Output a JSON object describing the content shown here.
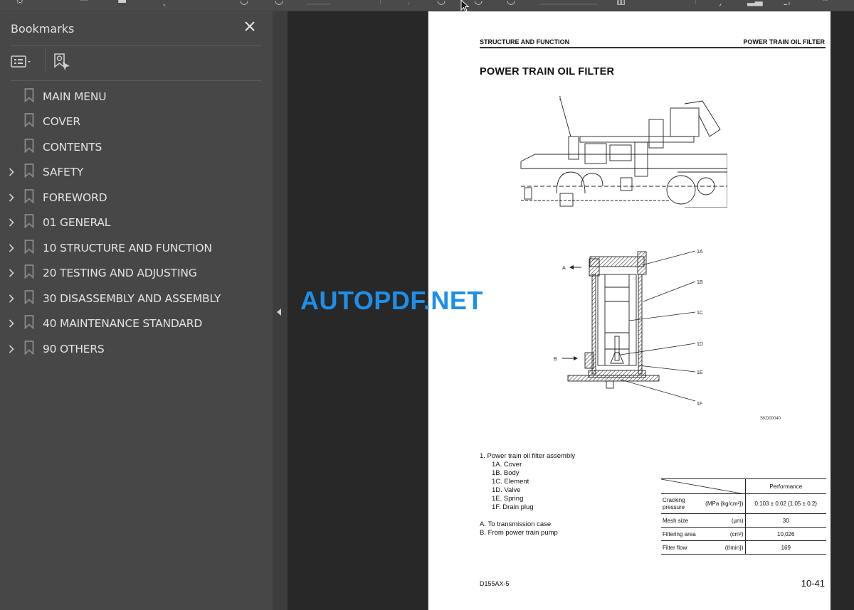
{
  "toolbar": {
    "icons": [
      "bookmark-star-icon",
      "upload-icon",
      "print-icon",
      "save-icon",
      "search-icon",
      "prev-page-icon",
      "next-page-icon",
      "select-cursor-icon",
      "zoom-out-icon",
      "zoom-in-icon",
      "fit-page-icon",
      "rotate-icon",
      "comment-icon",
      "highlight-icon",
      "sign-icon",
      "more-tools-icon"
    ]
  },
  "sidebar": {
    "title": "Bookmarks",
    "close_label": "✕",
    "items": [
      {
        "label": "MAIN MENU",
        "expandable": false
      },
      {
        "label": "COVER",
        "expandable": false
      },
      {
        "label": "CONTENTS",
        "expandable": false
      },
      {
        "label": "SAFETY",
        "expandable": true
      },
      {
        "label": "FOREWORD",
        "expandable": true
      },
      {
        "label": "01 GENERAL",
        "expandable": true
      },
      {
        "label": "10 STRUCTURE AND FUNCTION",
        "expandable": true
      },
      {
        "label": "20 TESTING AND ADJUSTING",
        "expandable": true
      },
      {
        "label": "30 DISASSEMBLY AND ASSEMBLY",
        "expandable": true
      },
      {
        "label": "40 MAINTENANCE STANDARD",
        "expandable": true
      },
      {
        "label": "90 OTHERS",
        "expandable": true
      }
    ]
  },
  "document": {
    "header_left": "STRUCTURE AND FUNCTION",
    "header_right": "POWER TRAIN OIL FILTER",
    "title": "POWER TRAIN OIL FILTER",
    "figure_callouts": {
      "top": "1",
      "a": "A",
      "b": "B",
      "c1a": "1A",
      "c1b": "1B",
      "c1c": "1C",
      "c1d": "1D",
      "c1e": "1E",
      "c1f": "1F"
    },
    "figure_code": "SKD00040",
    "parts": {
      "main": "1.  Power train oil filter assembly",
      "subs": [
        "1A. Cover",
        "1B. Body",
        "1C. Element",
        "1D. Valve",
        "1E. Spring",
        "1F. Drain plug"
      ],
      "flows": [
        "A.  To transmission case",
        "B.  From power train pump"
      ]
    },
    "performance_table": {
      "header": "Performance",
      "rows": [
        {
          "label": "Cracking pressure",
          "label_line1": "Cracking",
          "label_line2": "pressure",
          "unit": "(MPa {kg/cm²})",
          "value": "0.103 ± 0.02 {1.05 ± 0.2}"
        },
        {
          "label": "Mesh size",
          "unit": "(µm)",
          "value": "30"
        },
        {
          "label": "Filtering area",
          "unit": "(cm²)",
          "value": "10,026"
        },
        {
          "label": "Filter flow",
          "unit": "(ℓ/min})",
          "value": "169"
        }
      ]
    },
    "footer_left": "D155AX-5",
    "footer_right": "10-41"
  },
  "watermark": "AUTOPDF.NET",
  "colors": {
    "watermark": "#1e8fe8",
    "sidebar_bg": "#474747",
    "viewer_bg": "#282828"
  }
}
